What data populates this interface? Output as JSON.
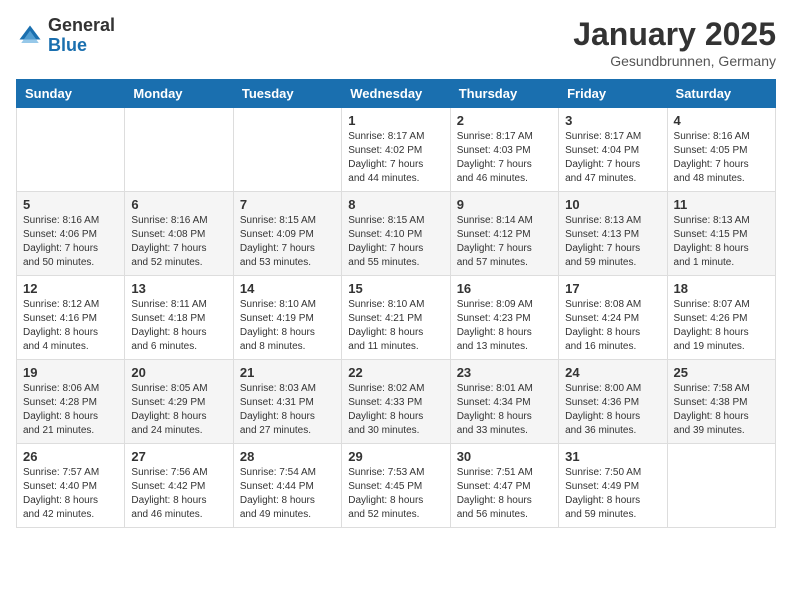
{
  "header": {
    "logo_general": "General",
    "logo_blue": "Blue",
    "month_title": "January 2025",
    "location": "Gesundbrunnen, Germany"
  },
  "weekdays": [
    "Sunday",
    "Monday",
    "Tuesday",
    "Wednesday",
    "Thursday",
    "Friday",
    "Saturday"
  ],
  "weeks": [
    [
      {
        "day": "",
        "info": ""
      },
      {
        "day": "",
        "info": ""
      },
      {
        "day": "",
        "info": ""
      },
      {
        "day": "1",
        "info": "Sunrise: 8:17 AM\nSunset: 4:02 PM\nDaylight: 7 hours\nand 44 minutes."
      },
      {
        "day": "2",
        "info": "Sunrise: 8:17 AM\nSunset: 4:03 PM\nDaylight: 7 hours\nand 46 minutes."
      },
      {
        "day": "3",
        "info": "Sunrise: 8:17 AM\nSunset: 4:04 PM\nDaylight: 7 hours\nand 47 minutes."
      },
      {
        "day": "4",
        "info": "Sunrise: 8:16 AM\nSunset: 4:05 PM\nDaylight: 7 hours\nand 48 minutes."
      }
    ],
    [
      {
        "day": "5",
        "info": "Sunrise: 8:16 AM\nSunset: 4:06 PM\nDaylight: 7 hours\nand 50 minutes."
      },
      {
        "day": "6",
        "info": "Sunrise: 8:16 AM\nSunset: 4:08 PM\nDaylight: 7 hours\nand 52 minutes."
      },
      {
        "day": "7",
        "info": "Sunrise: 8:15 AM\nSunset: 4:09 PM\nDaylight: 7 hours\nand 53 minutes."
      },
      {
        "day": "8",
        "info": "Sunrise: 8:15 AM\nSunset: 4:10 PM\nDaylight: 7 hours\nand 55 minutes."
      },
      {
        "day": "9",
        "info": "Sunrise: 8:14 AM\nSunset: 4:12 PM\nDaylight: 7 hours\nand 57 minutes."
      },
      {
        "day": "10",
        "info": "Sunrise: 8:13 AM\nSunset: 4:13 PM\nDaylight: 7 hours\nand 59 minutes."
      },
      {
        "day": "11",
        "info": "Sunrise: 8:13 AM\nSunset: 4:15 PM\nDaylight: 8 hours\nand 1 minute."
      }
    ],
    [
      {
        "day": "12",
        "info": "Sunrise: 8:12 AM\nSunset: 4:16 PM\nDaylight: 8 hours\nand 4 minutes."
      },
      {
        "day": "13",
        "info": "Sunrise: 8:11 AM\nSunset: 4:18 PM\nDaylight: 8 hours\nand 6 minutes."
      },
      {
        "day": "14",
        "info": "Sunrise: 8:10 AM\nSunset: 4:19 PM\nDaylight: 8 hours\nand 8 minutes."
      },
      {
        "day": "15",
        "info": "Sunrise: 8:10 AM\nSunset: 4:21 PM\nDaylight: 8 hours\nand 11 minutes."
      },
      {
        "day": "16",
        "info": "Sunrise: 8:09 AM\nSunset: 4:23 PM\nDaylight: 8 hours\nand 13 minutes."
      },
      {
        "day": "17",
        "info": "Sunrise: 8:08 AM\nSunset: 4:24 PM\nDaylight: 8 hours\nand 16 minutes."
      },
      {
        "day": "18",
        "info": "Sunrise: 8:07 AM\nSunset: 4:26 PM\nDaylight: 8 hours\nand 19 minutes."
      }
    ],
    [
      {
        "day": "19",
        "info": "Sunrise: 8:06 AM\nSunset: 4:28 PM\nDaylight: 8 hours\nand 21 minutes."
      },
      {
        "day": "20",
        "info": "Sunrise: 8:05 AM\nSunset: 4:29 PM\nDaylight: 8 hours\nand 24 minutes."
      },
      {
        "day": "21",
        "info": "Sunrise: 8:03 AM\nSunset: 4:31 PM\nDaylight: 8 hours\nand 27 minutes."
      },
      {
        "day": "22",
        "info": "Sunrise: 8:02 AM\nSunset: 4:33 PM\nDaylight: 8 hours\nand 30 minutes."
      },
      {
        "day": "23",
        "info": "Sunrise: 8:01 AM\nSunset: 4:34 PM\nDaylight: 8 hours\nand 33 minutes."
      },
      {
        "day": "24",
        "info": "Sunrise: 8:00 AM\nSunset: 4:36 PM\nDaylight: 8 hours\nand 36 minutes."
      },
      {
        "day": "25",
        "info": "Sunrise: 7:58 AM\nSunset: 4:38 PM\nDaylight: 8 hours\nand 39 minutes."
      }
    ],
    [
      {
        "day": "26",
        "info": "Sunrise: 7:57 AM\nSunset: 4:40 PM\nDaylight: 8 hours\nand 42 minutes."
      },
      {
        "day": "27",
        "info": "Sunrise: 7:56 AM\nSunset: 4:42 PM\nDaylight: 8 hours\nand 46 minutes."
      },
      {
        "day": "28",
        "info": "Sunrise: 7:54 AM\nSunset: 4:44 PM\nDaylight: 8 hours\nand 49 minutes."
      },
      {
        "day": "29",
        "info": "Sunrise: 7:53 AM\nSunset: 4:45 PM\nDaylight: 8 hours\nand 52 minutes."
      },
      {
        "day": "30",
        "info": "Sunrise: 7:51 AM\nSunset: 4:47 PM\nDaylight: 8 hours\nand 56 minutes."
      },
      {
        "day": "31",
        "info": "Sunrise: 7:50 AM\nSunset: 4:49 PM\nDaylight: 8 hours\nand 59 minutes."
      },
      {
        "day": "",
        "info": ""
      }
    ]
  ]
}
